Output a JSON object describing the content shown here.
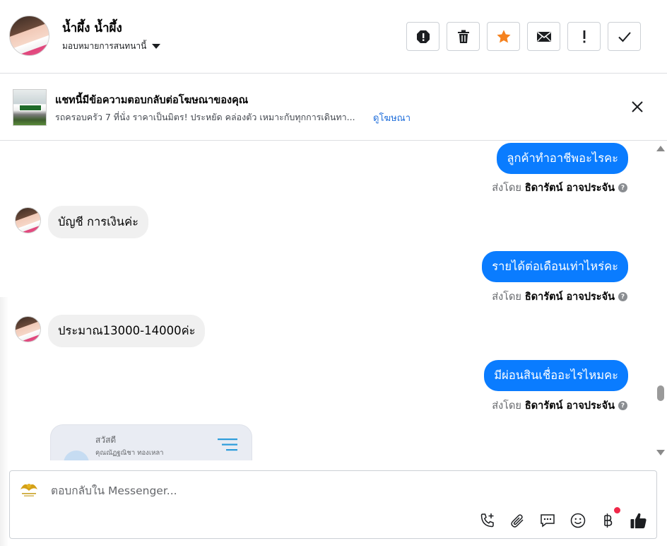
{
  "header": {
    "contact_name": "น้ำผึ้ง น้ำผึ้ง",
    "assign_label": "มอบหมายการสนทนานี้"
  },
  "ad_banner": {
    "title": "แชทนี้มีข้อความตอบกลับต่อโฆษณาของคุณ",
    "description": "รถครอบครัว 7 ที่นั่ง ราคาเป็นมิตร! ประหยัด คล่องตัว เหมาะกับทุกการเดินทา...",
    "link_label": "ดูโฆษณา"
  },
  "messages": [
    {
      "direction": "out",
      "text": "ลูกค้าทำอาชีพอะไรคะ",
      "sent_by_prefix": "ส่งโดย",
      "sent_by_name": "ธิดารัตน์ อาจประจัน"
    },
    {
      "direction": "in",
      "text": "บัญชี  การเงินค่ะ"
    },
    {
      "direction": "out",
      "text": "รายได้ต่อเดือนเท่าไหร่คะ",
      "sent_by_prefix": "ส่งโดย",
      "sent_by_name": "ธิดารัตน์ อาจประจัน"
    },
    {
      "direction": "in",
      "text": "ประมาณ13000-14000ค่ะ"
    },
    {
      "direction": "out",
      "text": "มีผ่อนสินเชื่ออะไรไหมคะ",
      "sent_by_prefix": "ส่งโดย",
      "sent_by_name": "ธิดารัตน์ อาจประจัน"
    }
  ],
  "card": {
    "greeting": "สวัสดี",
    "name": "คุณณัฏฐณิชา ทองเหลา"
  },
  "composer": {
    "placeholder": "ตอบกลับใน Messenger..."
  },
  "colors": {
    "outgoing_bubble": "#0a7cff",
    "incoming_bubble": "#f0f0f0",
    "star": "#f5821f",
    "link": "#216fdb",
    "notification_dot": "#f02849"
  },
  "icons": {
    "toolbar": [
      "spam-icon",
      "trash-icon",
      "star-icon",
      "envelope-icon",
      "exclamation-icon",
      "check-icon"
    ],
    "composer": [
      "add-call-icon",
      "attachment-icon",
      "saved-replies-icon",
      "emoji-icon",
      "baht-icon",
      "like-icon"
    ]
  }
}
